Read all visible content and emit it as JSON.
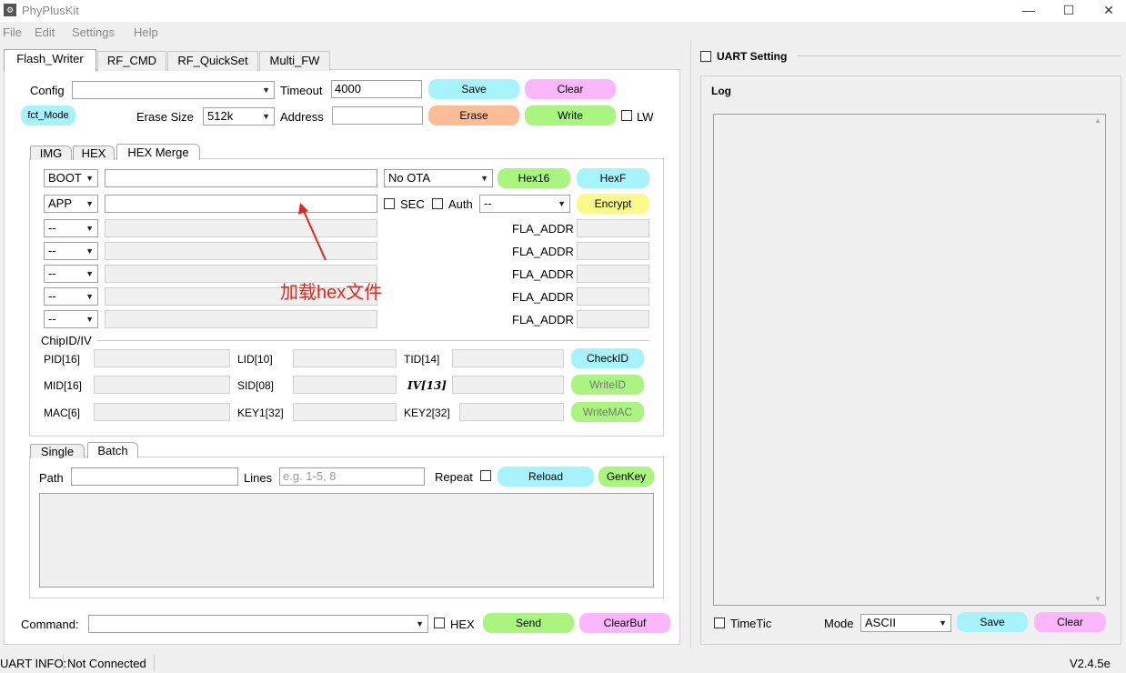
{
  "window": {
    "title": "PhyPlusKit",
    "icon": "app-icon",
    "minimize": "—",
    "maximize": "☐",
    "close": "✕"
  },
  "menu": [
    "File",
    "Edit",
    "Settings",
    "Help"
  ],
  "tabs": [
    "Flash_Writer",
    "RF_CMD",
    "RF_QuickSet",
    "Multi_FW"
  ],
  "top": {
    "config_label": "Config",
    "config_value": "",
    "timeout_label": "Timeout",
    "timeout_value": "4000",
    "save": "Save",
    "clear": "Clear",
    "fct_mode": "fct_Mode",
    "erase_size_label": "Erase Size",
    "erase_size_value": "512k",
    "address_label": "Address",
    "address_value": "",
    "erase": "Erase",
    "write": "Write",
    "lw_label": "LW"
  },
  "subtabs": [
    "IMG",
    "HEX",
    "HEX Merge"
  ],
  "hex": {
    "rows": [
      {
        "type": "BOOT",
        "path": ""
      },
      {
        "type": "APP",
        "path": ""
      },
      {
        "type": "--",
        "path": ""
      },
      {
        "type": "--",
        "path": ""
      },
      {
        "type": "--",
        "path": ""
      },
      {
        "type": "--",
        "path": ""
      },
      {
        "type": "--",
        "path": ""
      }
    ],
    "ota": "No OTA",
    "hex16": "Hex16",
    "hexf": "HexF",
    "sec": "SEC",
    "auth": "Auth",
    "auth_value": "--",
    "encrypt": "Encrypt",
    "fla_addr": "FLA_ADDR"
  },
  "chipid": {
    "group": "ChipID/IV",
    "pid": "PID[16]",
    "lid": "LID[10]",
    "tid": "TID[14]",
    "checkid": "CheckID",
    "mid": "MID[16]",
    "sid": "SID[08]",
    "iv": "IV[13]",
    "writeid": "WriteID",
    "mac": "MAC[6]",
    "key1": "KEY1[32]",
    "key2": "KEY2[32]",
    "writemac": "WriteMAC"
  },
  "batch": {
    "tabs": [
      "Single",
      "Batch"
    ],
    "path_label": "Path",
    "path_value": "",
    "lines_label": "Lines",
    "lines_placeholder": "e.g. 1-5, 8",
    "repeat": "Repeat",
    "reload": "Reload",
    "genkey": "GenKey"
  },
  "command": {
    "label": "Command:",
    "value": "",
    "hex": "HEX",
    "send": "Send",
    "clearbuf": "ClearBuf"
  },
  "right": {
    "uart_setting": "UART Setting",
    "log": "Log",
    "timetic": "TimeTic",
    "mode_label": "Mode",
    "mode_value": "ASCII",
    "save": "Save",
    "clear": "Clear"
  },
  "annotation": "加载hex文件",
  "status": {
    "uart_info": "UART INFO:",
    "state": "Not Connected",
    "version": "V2.4.5e"
  },
  "colors": {
    "cyan": "#a6f3fc",
    "pink": "#fcb6fb",
    "orange": "#fcbd96",
    "green": "#a9f57f",
    "yellow": "#fafa8a",
    "annotation": "#e0281e"
  }
}
